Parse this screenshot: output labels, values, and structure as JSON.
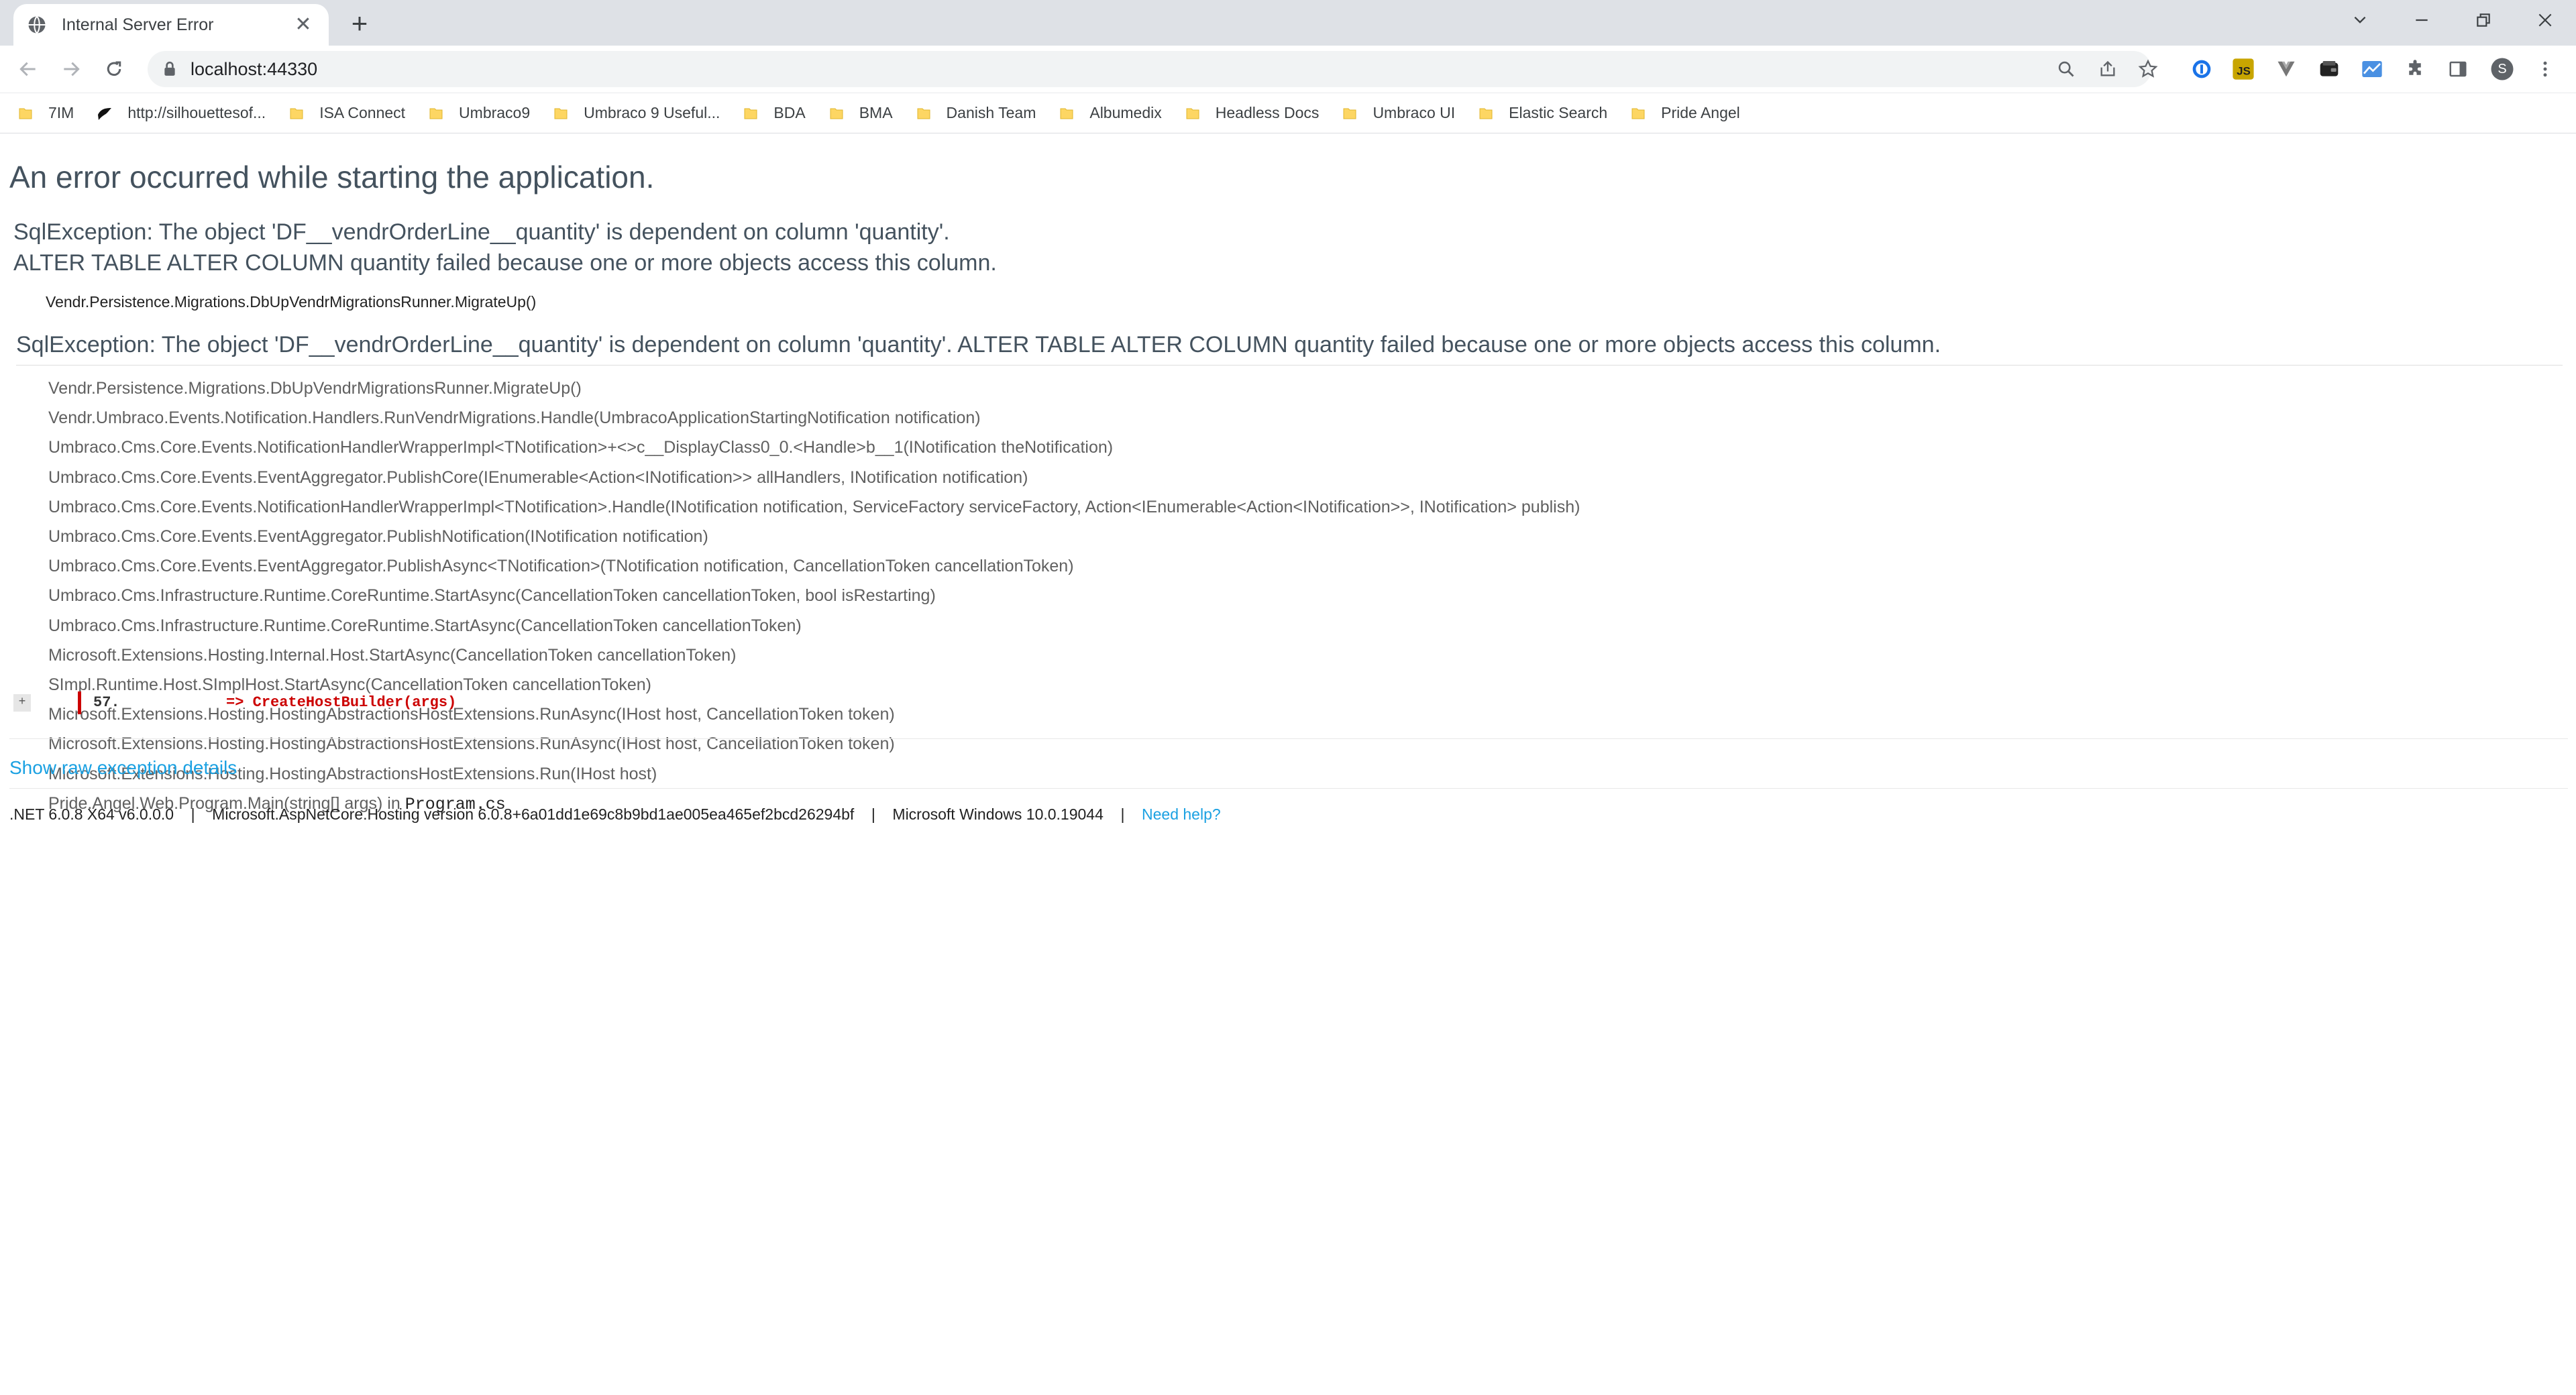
{
  "browser": {
    "tab_title": "Internal Server Error",
    "new_tab_symbol": "+",
    "url": "localhost:44330",
    "profile_initial": "S",
    "bookmarks": [
      {
        "label": "7IM",
        "icon": "folder-icon"
      },
      {
        "label": "http://silhouettesof...",
        "icon": "bird-icon"
      },
      {
        "label": "ISA Connect",
        "icon": "folder-icon"
      },
      {
        "label": "Umbraco9",
        "icon": "folder-icon"
      },
      {
        "label": "Umbraco  9 Useful...",
        "icon": "folder-icon"
      },
      {
        "label": "BDA",
        "icon": "folder-icon"
      },
      {
        "label": "BMA",
        "icon": "folder-icon"
      },
      {
        "label": "Danish Team",
        "icon": "folder-icon"
      },
      {
        "label": "Albumedix",
        "icon": "folder-icon"
      },
      {
        "label": "Headless Docs",
        "icon": "folder-icon"
      },
      {
        "label": "Umbraco UI",
        "icon": "folder-icon"
      },
      {
        "label": "Elastic Search",
        "icon": "folder-icon"
      },
      {
        "label": "Pride Angel",
        "icon": "folder-icon"
      }
    ],
    "colors": {
      "tabstrip": "#dee1e6",
      "folder": "#fdd663",
      "link": "#1ba1e2",
      "error_red": "#cc0000"
    }
  },
  "error_page": {
    "heading": "An error occurred while starting the application.",
    "message_line1": "SqlException: The object 'DF__vendrOrderLine__quantity' is dependent on column 'quantity'.",
    "message_line2": "ALTER TABLE ALTER COLUMN quantity failed because one or more objects access this column.",
    "location": "Vendr.Persistence.Migrations.DbUpVendrMigrationsRunner.MigrateUp()",
    "exception_title": "SqlException: The object 'DF__vendrOrderLine__quantity' is dependent on column 'quantity'. ALTER TABLE ALTER COLUMN quantity failed because one or more objects access this column.",
    "stack_frames": [
      "Vendr.Persistence.Migrations.DbUpVendrMigrationsRunner.MigrateUp()",
      "Vendr.Umbraco.Events.Notification.Handlers.RunVendrMigrations.Handle(UmbracoApplicationStartingNotification notification)",
      "Umbraco.Cms.Core.Events.NotificationHandlerWrapperImpl<TNotification>+<>c__DisplayClass0_0.<Handle>b__1(INotification theNotification)",
      "Umbraco.Cms.Core.Events.EventAggregator.PublishCore(IEnumerable<Action<INotification>> allHandlers, INotification notification)",
      "Umbraco.Cms.Core.Events.NotificationHandlerWrapperImpl<TNotification>.Handle(INotification notification, ServiceFactory serviceFactory, Action<IEnumerable<Action<INotification>>, INotification> publish)",
      "Umbraco.Cms.Core.Events.EventAggregator.PublishNotification(INotification notification)",
      "Umbraco.Cms.Core.Events.EventAggregator.PublishAsync<TNotification>(TNotification notification, CancellationToken cancellationToken)",
      "Umbraco.Cms.Infrastructure.Runtime.CoreRuntime.StartAsync(CancellationToken cancellationToken, bool isRestarting)",
      "Umbraco.Cms.Infrastructure.Runtime.CoreRuntime.StartAsync(CancellationToken cancellationToken)",
      "Microsoft.Extensions.Hosting.Internal.Host.StartAsync(CancellationToken cancellationToken)",
      "SImpl.Runtime.Host.SImplHost.StartAsync(CancellationToken cancellationToken)",
      "Microsoft.Extensions.Hosting.HostingAbstractionsHostExtensions.RunAsync(IHost host, CancellationToken token)",
      "Microsoft.Extensions.Hosting.HostingAbstractionsHostExtensions.RunAsync(IHost host, CancellationToken token)",
      "Microsoft.Extensions.Hosting.HostingAbstractionsHostExtensions.Run(IHost host)"
    ],
    "last_frame": {
      "method": "Pride.Angel.Web.Program.Main(string[] args) in ",
      "file": "Program.cs"
    },
    "source": {
      "expander": "+",
      "line_number": "57.",
      "code": "            => CreateHostBuilder(args)"
    },
    "show_raw_label": "Show raw exception details",
    "footer": {
      "runtime": ".NET 6.0.8 X64 v6.0.0.0",
      "separator": "|",
      "hosting": "Microsoft.AspNetCore.Hosting version 6.0.8+6a01dd1e69c8b9bd1ae005ea465ef2bcd26294bf",
      "os": "Microsoft Windows 10.0.19044",
      "help": "Need help?"
    }
  }
}
